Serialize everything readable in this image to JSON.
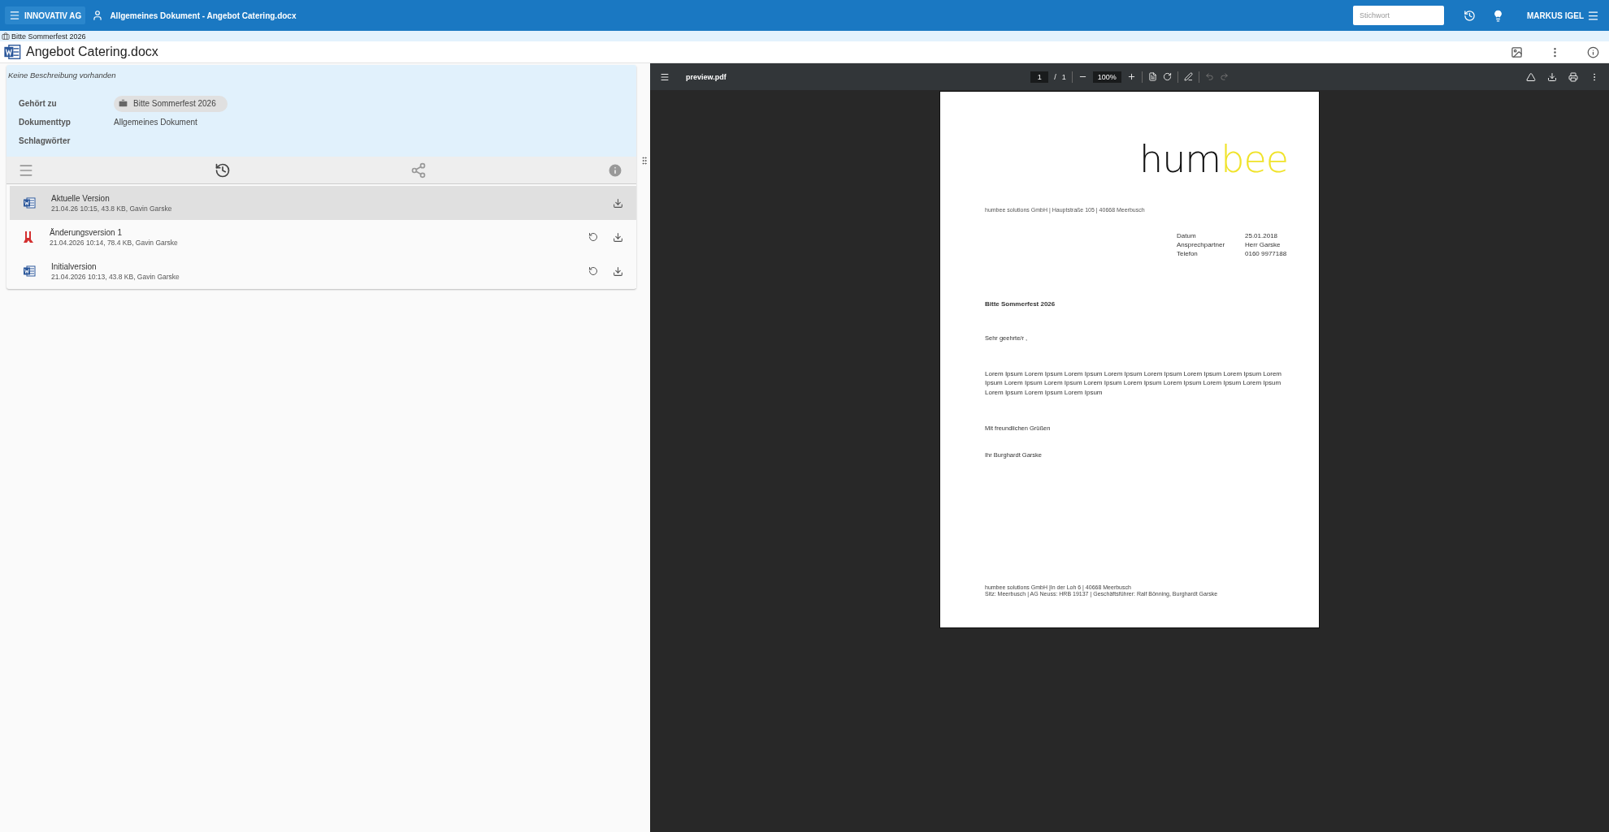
{
  "topbar": {
    "org_button": "INNOVATIV AG",
    "context": "Allgemeines Dokument - Angebot Catering.docx",
    "search": {
      "placeholder": "Stichwort"
    },
    "user": "MARKUS IGEL"
  },
  "breadcrumb": "Bitte Sommerfest 2026",
  "document": {
    "title": "Angebot Catering.docx"
  },
  "details": {
    "description": "Keine Beschreibung vorhanden",
    "fields": [
      {
        "label": "Gehört zu",
        "kind": "chip",
        "value": "Bitte Sommerfest 2026"
      },
      {
        "label": "Dokumenttyp",
        "kind": "text",
        "value": "Allgemeines Dokument"
      },
      {
        "label": "Schlagwörter",
        "kind": "text"
      }
    ]
  },
  "panel_tabs": [
    {
      "kind": "menu",
      "selected": false
    },
    {
      "kind": "history",
      "selected": true
    },
    {
      "kind": "share",
      "selected": false
    },
    {
      "kind": "info",
      "selected": false
    }
  ],
  "versions": [
    {
      "name": "Aktuelle Version",
      "meta": "21.04.26 10:15, 43.8 KB, Gavin Garske",
      "kind": "word",
      "selected": true,
      "restorable": false
    },
    {
      "name": "Änderungsversion 1",
      "meta": "21.04.2026 10:14, 78.4 KB, Gavin Garske",
      "kind": "pdf",
      "selected": false,
      "restorable": true
    },
    {
      "name": "Initialversion",
      "meta": "21.04.2026 10:13, 43.8 KB, Gavin Garske",
      "kind": "word",
      "selected": false,
      "restorable": true
    }
  ],
  "viewer": {
    "filename": "preview.pdf",
    "page": "1",
    "separator": "/",
    "pages": "1",
    "zoom": "100%",
    "letter": {
      "logo_dark": "hum",
      "logo_accent": "bee",
      "sender": "humbee solutions GmbH | Hauptstraße 105 | 40668 Meerbusch",
      "info": [
        {
          "label": "Datum",
          "value": "25.01.2018"
        },
        {
          "label": "Ansprechpartner",
          "value": "Herr Garske"
        },
        {
          "label": "Telefon",
          "value": "0160 9977188"
        }
      ],
      "subject": "Bitte Sommerfest 2026",
      "salutation": "Sehr geehrte/r ,",
      "body": "Lorem Ipsum Lorem Ipsum Lorem Ipsum Lorem Ipsum Lorem Ipsum Lorem Ipsum Lorem Ipsum Lorem Ipsum Lorem Ipsum Lorem Ipsum Lorem Ipsum Lorem Ipsum Lorem Ipsum Lorem Ipsum Lorem Ipsum Lorem Ipsum Lorem Ipsum Lorem Ipsum",
      "closing": "Mit freundlichen Grüßen",
      "signature": "Ihr Burghardt Garske",
      "footer": [
        "humbee solutions GmbH |In der Loh 6 | 40668 Meerbusch",
        "Sitz: Meerbusch | AG Neuss: HRB 19137 | Geschäftsführer: Ralf Bönning, Burghardt Garske"
      ]
    }
  }
}
